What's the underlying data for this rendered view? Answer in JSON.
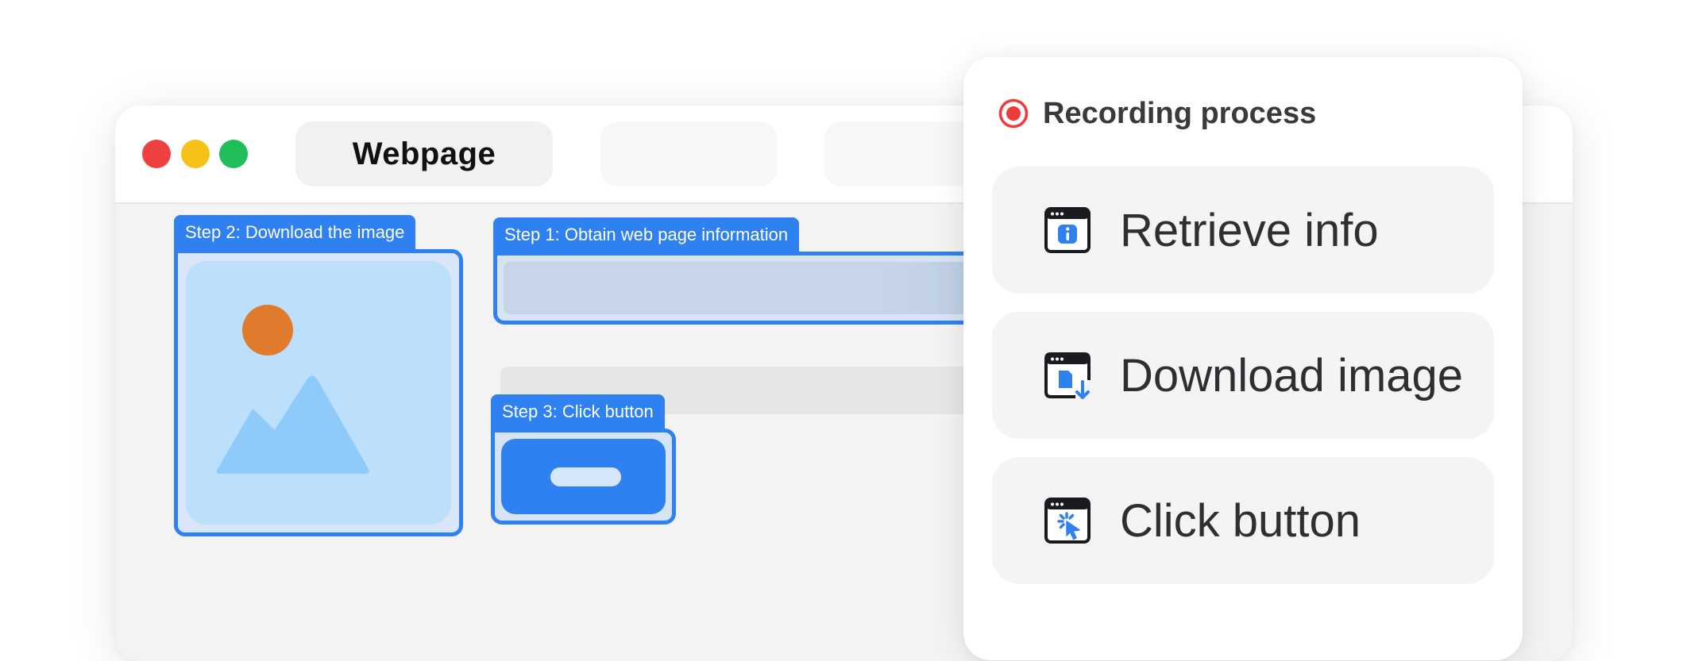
{
  "browser": {
    "active_tab_label": "Webpage"
  },
  "steps": {
    "step1_label": "Step 1: Obtain web page information",
    "step2_label": "Step 2: Download the image",
    "step3_label": "Step 3: Click button"
  },
  "panel": {
    "title": "Recording process",
    "actions": [
      {
        "label": "Retrieve info",
        "icon": "window-info-icon"
      },
      {
        "label": "Download image",
        "icon": "window-download-icon"
      },
      {
        "label": "Click button",
        "icon": "window-click-icon"
      }
    ]
  },
  "colors": {
    "accent": "#2f80f0",
    "record_red": "#ee3b3b",
    "sun_orange": "#e07a2c"
  }
}
